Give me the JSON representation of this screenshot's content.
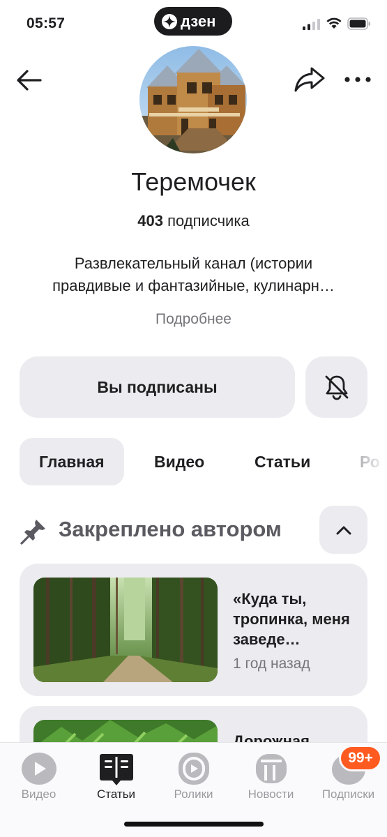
{
  "status_bar": {
    "time": "05:57",
    "app_pill_label": "дзен"
  },
  "channel": {
    "name": "Теремочек",
    "subscribers_count": "403",
    "subscribers_label": "подписчика",
    "description_line1": "Развлекательный канал (истории",
    "description_line2": "правдивые и фантазийные, кулинарн…",
    "more_label": "Подробнее"
  },
  "actions": {
    "subscribed_label": "Вы подписаны",
    "bell_icon": "bell-off-icon"
  },
  "tabs": [
    {
      "label": "Главная",
      "active": true
    },
    {
      "label": "Видео",
      "active": false
    },
    {
      "label": "Статьи",
      "active": false
    },
    {
      "label": "Ро",
      "active": false
    }
  ],
  "pinned": {
    "title": "Закреплено автором",
    "cards": [
      {
        "title": "«Куда ты, тропинка, меня заведе…",
        "time": "1 год назад",
        "image": "forest-path-photo"
      },
      {
        "title": "Дорожная",
        "time": "",
        "image": "ferns-photo"
      }
    ]
  },
  "bottom_nav": {
    "items": [
      {
        "label": "Видео",
        "icon": "video-icon",
        "active": false
      },
      {
        "label": "Статьи",
        "icon": "articles-icon",
        "active": true
      },
      {
        "label": "Ролики",
        "icon": "shorts-icon",
        "active": false
      },
      {
        "label": "Новости",
        "icon": "news-icon",
        "active": false
      },
      {
        "label": "Подписки",
        "icon": "subscriptions-icon",
        "active": false
      }
    ],
    "badge": "99+"
  },
  "colors": {
    "accent_badge": "#ff5a1f",
    "button_bg": "#ececf0",
    "muted_text": "#75757a"
  }
}
